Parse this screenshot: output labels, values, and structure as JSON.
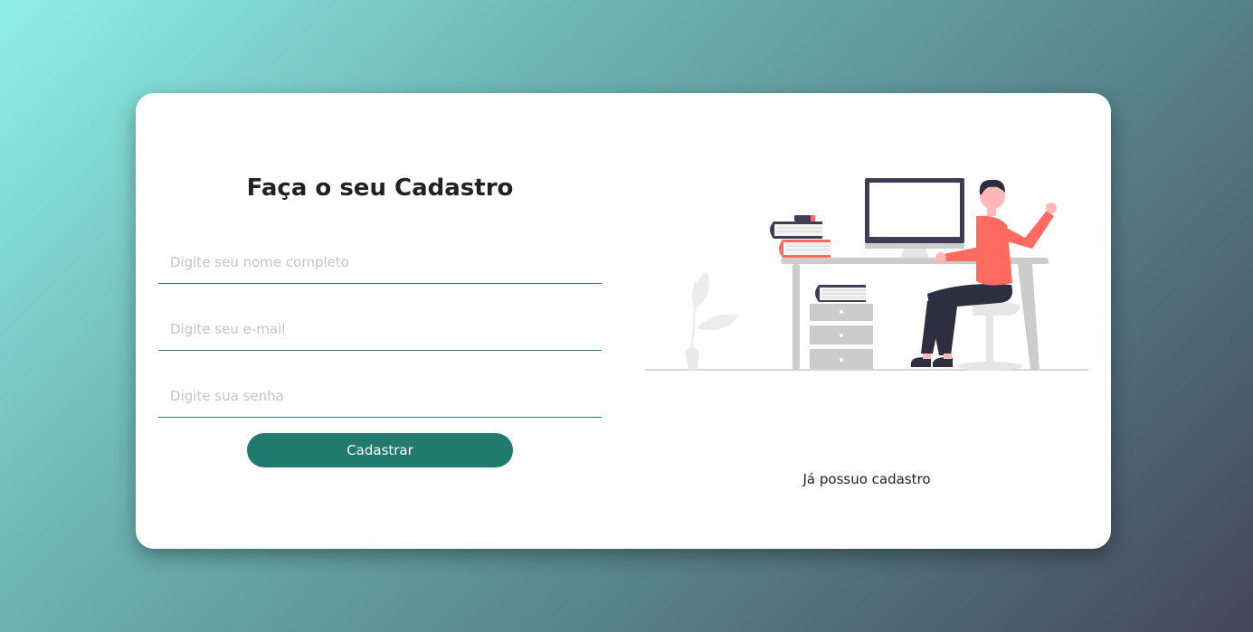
{
  "form": {
    "title": "Faça o seu Cadastro",
    "name_placeholder": "Digite seu nome completo",
    "email_placeholder": "Digite seu e-mail",
    "password_placeholder": "Digite sua senha",
    "submit_label": "Cadastrar"
  },
  "side": {
    "login_link": "Já possuo cadastro"
  },
  "colors": {
    "accent": "#227a6e",
    "person_shirt": "#ff6b61",
    "monitor": "#3f3d56",
    "furniture": "#cccccc"
  }
}
